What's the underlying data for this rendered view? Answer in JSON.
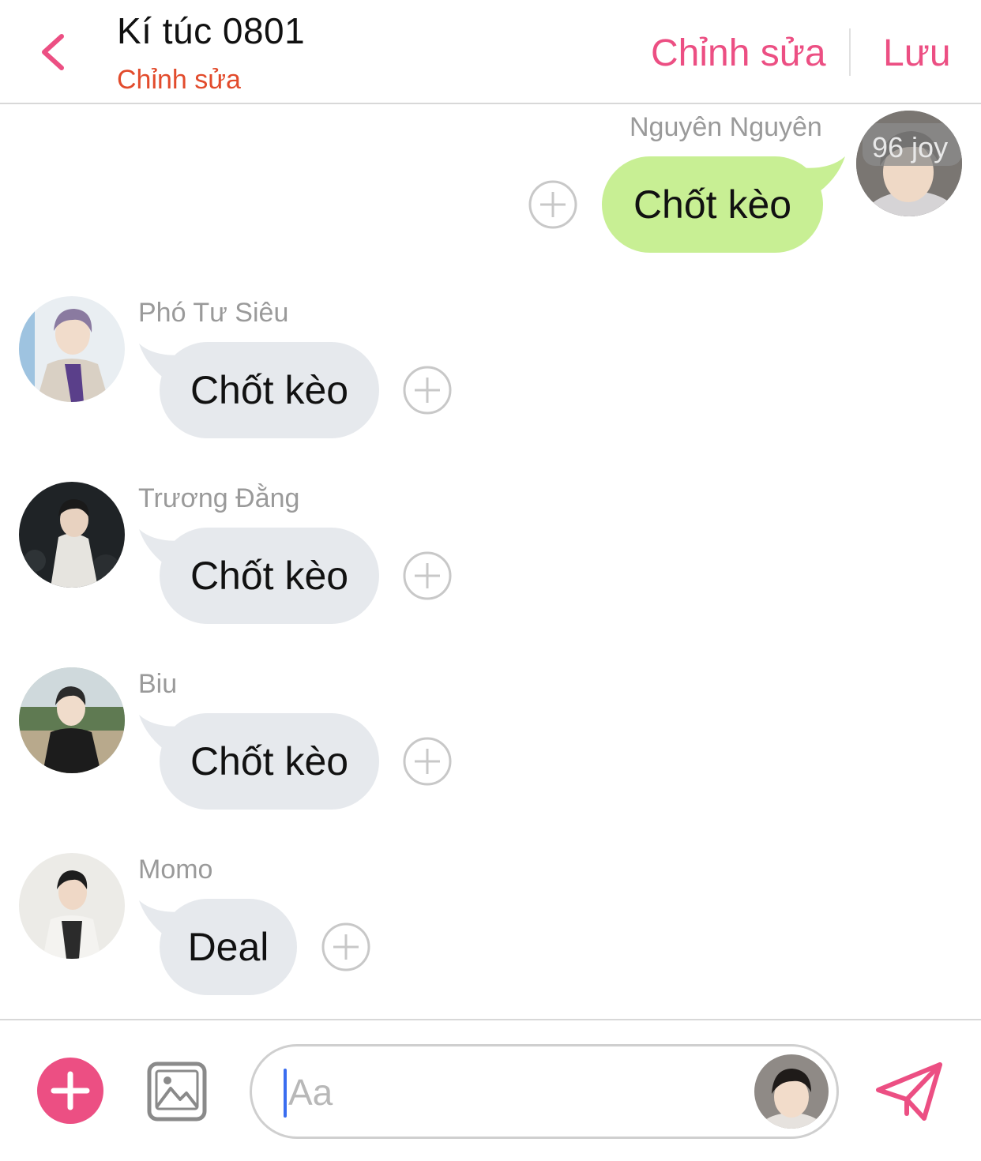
{
  "header": {
    "title": "Kí túc 0801",
    "subtitle": "Chỉnh sửa",
    "edit_label": "Chỉnh sửa",
    "save_label": "Lưu",
    "accent_color": "#ec4f83"
  },
  "messages": [
    {
      "sender": "Nguyên Nguyên",
      "text": "Chốt kèo",
      "direction": "outgoing",
      "avatar_badge": "96 joy"
    },
    {
      "sender": "Phó Tư Siêu",
      "text": "Chốt kèo",
      "direction": "incoming"
    },
    {
      "sender": "Trương Đằng",
      "text": "Chốt kèo",
      "direction": "incoming"
    },
    {
      "sender": "Biu",
      "text": "Chốt kèo",
      "direction": "incoming"
    },
    {
      "sender": "Momo",
      "text": "Deal",
      "direction": "incoming"
    }
  ],
  "composer": {
    "placeholder": "Aa",
    "value": ""
  },
  "icons": {
    "back": "chevron-left-icon",
    "reaction": "plus-circle-icon",
    "add": "plus-circle-filled-icon",
    "image": "image-icon",
    "send": "paper-plane-icon"
  }
}
